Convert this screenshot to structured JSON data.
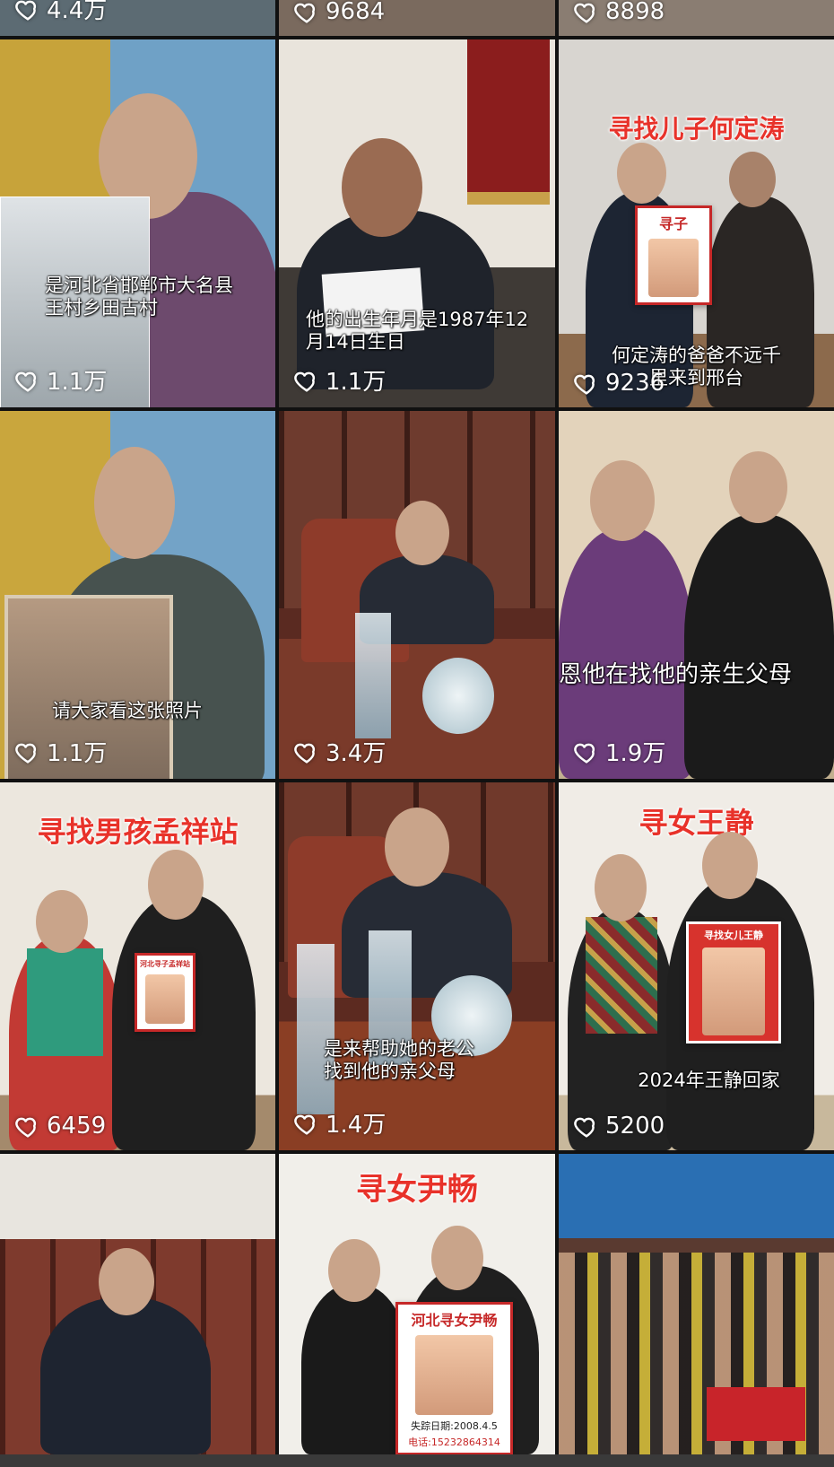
{
  "grid": {
    "top_row_likes": [
      "4.4万",
      "9684",
      "8898"
    ],
    "tiles": [
      {
        "likes": "1.1万",
        "subtitle": "是河北省邯郸市大名县王村乡田古村",
        "overlay_title": ""
      },
      {
        "likes": "1.1万",
        "subtitle": "他的出生年月是1987年12月14日生日",
        "overlay_title": ""
      },
      {
        "likes": "9236",
        "subtitle": "何定涛的爸爸不远千里来到邢台",
        "overlay_title": "寻找儿子何定涛",
        "poster_title": "寻子"
      },
      {
        "likes": "1.1万",
        "subtitle": "请大家看这张照片",
        "overlay_title": ""
      },
      {
        "likes": "3.4万",
        "subtitle": "",
        "overlay_title": ""
      },
      {
        "likes": "1.9万",
        "subtitle": "恩他在找他的亲生父母",
        "overlay_title": ""
      },
      {
        "likes": "6459",
        "subtitle": "",
        "overlay_title": "寻找男孩孟祥站",
        "poster_title": "河北寻子孟祥站"
      },
      {
        "likes": "1.4万",
        "subtitle": "是来帮助她的老公找到他的亲父母",
        "overlay_title": ""
      },
      {
        "likes": "5200",
        "subtitle": "2024年王静回家",
        "overlay_title": "寻女王静",
        "poster_title": "寻找女儿王静"
      },
      {
        "likes": "",
        "subtitle": "",
        "overlay_title": ""
      },
      {
        "likes": "",
        "subtitle": "",
        "overlay_title": "寻女尹畅",
        "poster_title": "河北寻女尹畅",
        "poster_lines": [
          "失踪日期:2008.4.5",
          "电话:15232864314"
        ]
      },
      {
        "likes": "",
        "subtitle": "",
        "overlay_title": ""
      }
    ]
  },
  "icons": {
    "like": "heart-outline-icon"
  },
  "colors": {
    "title_red": "#e8322a",
    "background": "#111111"
  }
}
